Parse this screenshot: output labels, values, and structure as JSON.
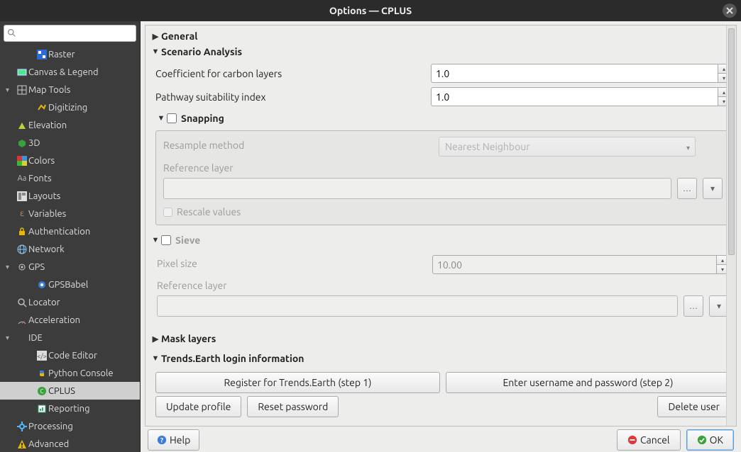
{
  "title": "Options — CPLUS",
  "search_placeholder": "",
  "sidebar": {
    "items": [
      {
        "label": "Raster",
        "icon": "raster-icon",
        "child": true,
        "arrow": ""
      },
      {
        "label": "Canvas & Legend",
        "icon": "canvas-icon",
        "arrow": ""
      },
      {
        "label": "Map Tools",
        "icon": "maptools-icon",
        "arrow": "▾"
      },
      {
        "label": "Digitizing",
        "icon": "digitizing-icon",
        "child": true,
        "arrow": ""
      },
      {
        "label": "Elevation",
        "icon": "elevation-icon",
        "arrow": ""
      },
      {
        "label": "3D",
        "icon": "3d-icon",
        "arrow": ""
      },
      {
        "label": "Colors",
        "icon": "colors-icon",
        "arrow": ""
      },
      {
        "label": "Fonts",
        "icon": "fonts-icon",
        "arrow": ""
      },
      {
        "label": "Layouts",
        "icon": "layouts-icon",
        "arrow": ""
      },
      {
        "label": "Variables",
        "icon": "variables-icon",
        "arrow": ""
      },
      {
        "label": "Authentication",
        "icon": "lock-icon",
        "arrow": ""
      },
      {
        "label": "Network",
        "icon": "network-icon",
        "arrow": ""
      },
      {
        "label": "GPS",
        "icon": "gps-icon",
        "arrow": "▾"
      },
      {
        "label": "GPSBabel",
        "icon": "gpsbabel-icon",
        "child": true,
        "arrow": ""
      },
      {
        "label": "Locator",
        "icon": "search-icon",
        "arrow": ""
      },
      {
        "label": "Acceleration",
        "icon": "accel-icon",
        "arrow": ""
      },
      {
        "label": "IDE",
        "icon": "",
        "arrow": "▾"
      },
      {
        "label": "Code Editor",
        "icon": "code-icon",
        "child": true,
        "arrow": ""
      },
      {
        "label": "Python Console",
        "icon": "python-icon",
        "child": true,
        "arrow": ""
      },
      {
        "label": "CPLUS",
        "icon": "cplus-icon",
        "child": true,
        "arrow": "",
        "selected": true
      },
      {
        "label": "Reporting",
        "icon": "reporting-icon",
        "child": true,
        "arrow": ""
      },
      {
        "label": "Processing",
        "icon": "gear-icon",
        "arrow": ""
      },
      {
        "label": "Advanced",
        "icon": "warning-icon",
        "arrow": ""
      }
    ]
  },
  "sections": {
    "general": "General",
    "scenario": "Scenario Analysis",
    "coef_label": "Coefficient for carbon layers",
    "coef_value": "1.0",
    "psi_label": "Pathway suitability index",
    "psi_value": "1.0",
    "snapping": "Snapping",
    "resample_label": "Resample method",
    "resample_value": "Nearest Neighbour",
    "reflayer_label": "Reference layer",
    "rescale_label": "Rescale values",
    "sieve": "Sieve",
    "pixel_label": "Pixel size",
    "pixel_value": "10.00",
    "reflayer2_label": "Reference layer",
    "mask": "Mask layers",
    "trends_title": "Trends.Earth login information",
    "register_btn": "Register for Trends.Earth (step 1)",
    "enter_btn": "Enter username and password (step 2)",
    "update_btn": "Update profile",
    "reset_btn": "Reset password",
    "delete_btn": "Delete user"
  },
  "footer": {
    "help": "Help",
    "cancel": "Cancel",
    "ok": "OK"
  }
}
